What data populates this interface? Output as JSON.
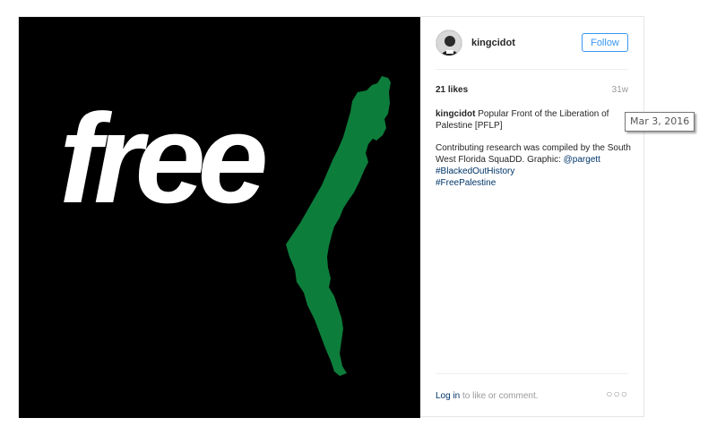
{
  "image": {
    "word": "free",
    "background_color": "#000000",
    "text_color": "#ffffff",
    "map_color": "#0d7d3b"
  },
  "header": {
    "username": "kingcidot",
    "follow_label": "Follow"
  },
  "stats": {
    "likes": "21 likes",
    "time_ago": "31w"
  },
  "caption": {
    "username": "kingcidot",
    "text": " Popular Front of the Liberation of Palestine [PFLP]",
    "line2_text": "Contributing research was compiled by the South West Florida SquaDD. Graphic: ",
    "mention": "@pargett",
    "hashtag1": "#BlackedOutHistory",
    "hashtag2": "#FreePalestine"
  },
  "footer": {
    "login_link": "Log in",
    "login_suffix": " to like or comment.",
    "more_icon": "more-dots-icon"
  },
  "tooltip": {
    "date": "Mar 3, 2016"
  },
  "colors": {
    "accent": "#3897f0",
    "link": "#003569",
    "muted": "#999999"
  }
}
